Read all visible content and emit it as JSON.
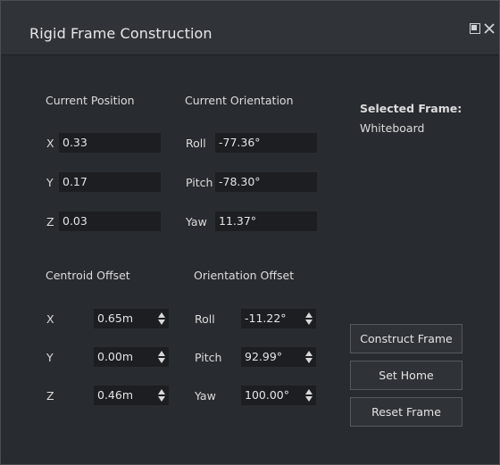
{
  "window": {
    "title": "Rigid Frame Construction"
  },
  "titlebar_icons": {
    "float": "float-icon",
    "close": "close-icon"
  },
  "current_position": {
    "heading": "Current Position",
    "x_label": "X",
    "x_value": "0.33",
    "y_label": "Y",
    "y_value": "0.17",
    "z_label": "Z",
    "z_value": "0.03"
  },
  "current_orientation": {
    "heading": "Current Orientation",
    "roll_label": "Roll",
    "roll_value": "-77.36°",
    "pitch_label": "Pitch",
    "pitch_value": "-78.30°",
    "yaw_label": "Yaw",
    "yaw_value": "11.37°"
  },
  "selected_frame": {
    "heading": "Selected Frame:",
    "value": "Whiteboard"
  },
  "centroid_offset": {
    "heading": "Centroid Offset",
    "x_label": "X",
    "x_value": "0.65m",
    "y_label": "Y",
    "y_value": "0.00m",
    "z_label": "Z",
    "z_value": "0.46m"
  },
  "orientation_offset": {
    "heading": "Orientation Offset",
    "roll_label": "Roll",
    "roll_value": "-11.22°",
    "pitch_label": "Pitch",
    "pitch_value": "92.99°",
    "yaw_label": "Yaw",
    "yaw_value": "100.00°"
  },
  "buttons": {
    "construct": "Construct Frame",
    "set_home": "Set Home",
    "reset": "Reset Frame"
  },
  "colors": {
    "panel_bg": "#282b2f",
    "titlebar_bg": "#303338",
    "field_bg": "#1c1e21"
  }
}
